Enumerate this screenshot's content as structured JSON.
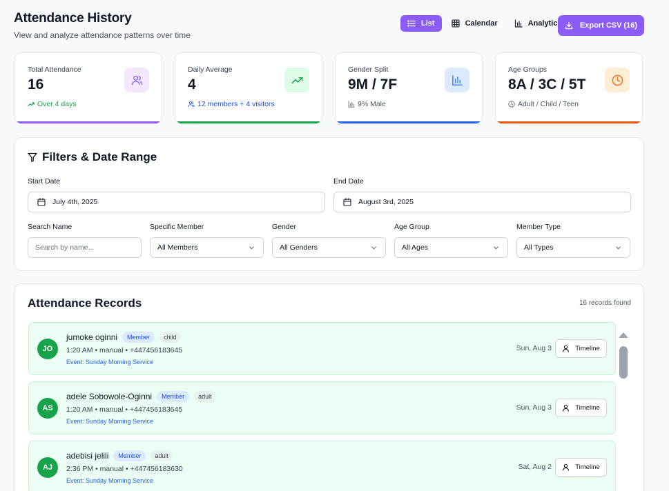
{
  "header": {
    "title": "Attendance History",
    "subtitle": "View and analyze attendance patterns over time"
  },
  "view_toggle": {
    "list": "List",
    "calendar": "Calendar",
    "analytics": "Analytics",
    "active": "List"
  },
  "export": {
    "label": "Export CSV (16)"
  },
  "stats": [
    {
      "label": "Total Attendance",
      "value": "16",
      "foot": "Over 4 days",
      "foot_color": "#16a34a",
      "icon": "users-icon",
      "icon_bg": "#f3e8ff",
      "icon_color": "#8b5cf6",
      "bar_color": "#8b5cf6"
    },
    {
      "label": "Daily Average",
      "value": "4",
      "foot": "12 members + 4 visitors",
      "foot_color": "#1d4ed8",
      "icon": "trending-up-icon",
      "icon_bg": "#dcfce7",
      "icon_color": "#16a34a",
      "bar_color": "#16a34a"
    },
    {
      "label": "Gender Split",
      "value": "9M / 7F",
      "foot": "9% Male",
      "foot_color": "#4b5563",
      "icon": "bar-chart-icon",
      "icon_bg": "#dbeafe",
      "icon_color": "#3b82f6",
      "bar_color": "#2563eb"
    },
    {
      "label": "Age Groups",
      "value": "8A / 3C / 5T",
      "foot": "Adult / Child / Teen",
      "foot_color": "#4b5563",
      "icon": "clock-icon",
      "icon_bg": "#ffedd5",
      "icon_color": "#f97316",
      "bar_color": "#ea580c"
    }
  ],
  "filters": {
    "title": "Filters & Date Range",
    "start_date": {
      "label": "Start Date",
      "value": "July 4th, 2025"
    },
    "end_date": {
      "label": "End Date",
      "value": "August 3rd, 2025"
    },
    "search": {
      "label": "Search Name",
      "placeholder": "Search by name..."
    },
    "member": {
      "label": "Specific Member",
      "value": "All Members"
    },
    "gender": {
      "label": "Gender",
      "value": "All Genders"
    },
    "age_group": {
      "label": "Age Group",
      "value": "All Ages"
    },
    "member_type": {
      "label": "Member Type",
      "value": "All Types"
    }
  },
  "records": {
    "title": "Attendance Records",
    "count": "16 records found",
    "timeline_label": "Timeline",
    "items": [
      {
        "initials": "JO",
        "name": "jumoke oginni",
        "type": "Member",
        "age": "child",
        "meta": "1:20 AM • manual • +447456183645",
        "event": "Event: Sunday Morning Service",
        "date": "Sun, Aug 3"
      },
      {
        "initials": "AS",
        "name": "adele Sobowole-Oginni",
        "type": "Member",
        "age": "adult",
        "meta": "1:20 AM • manual • +447456183645",
        "event": "Event: Sunday Morning Service",
        "date": "Sun, Aug 3"
      },
      {
        "initials": "AJ",
        "name": "adebisi jelili",
        "type": "Member",
        "age": "adult",
        "meta": "2:36 PM • manual • +447456183630",
        "event": "Event: Sunday Morning Service",
        "date": "Sat, Aug 2"
      }
    ]
  }
}
